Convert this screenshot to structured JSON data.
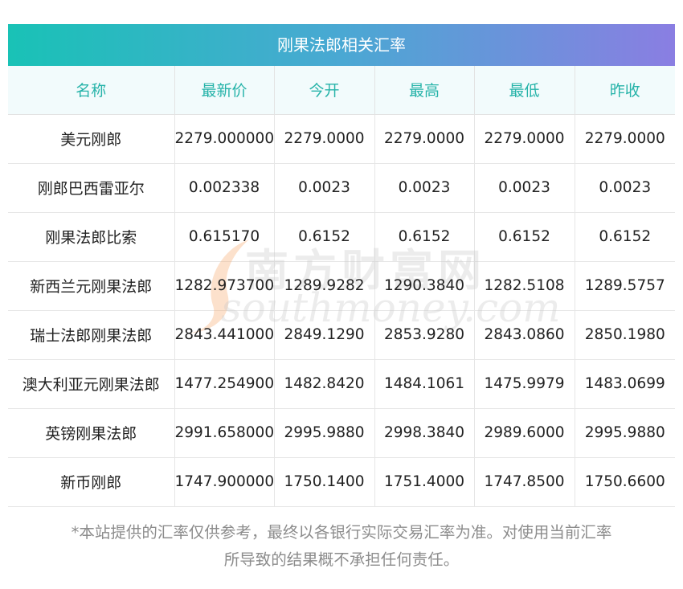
{
  "title": "刚果法郎相关汇率",
  "columns": [
    "名称",
    "最新价",
    "今开",
    "最高",
    "最低",
    "昨收"
  ],
  "rows": [
    [
      "美元刚郎",
      "2279.000000",
      "2279.0000",
      "2279.0000",
      "2279.0000",
      "2279.0000"
    ],
    [
      "刚郎巴西雷亚尔",
      "0.002338",
      "0.0023",
      "0.0023",
      "0.0023",
      "0.0023"
    ],
    [
      "刚果法郎比索",
      "0.615170",
      "0.6152",
      "0.6152",
      "0.6152",
      "0.6152"
    ],
    [
      "新西兰元刚果法郎",
      "1282.973700",
      "1289.9282",
      "1290.3840",
      "1282.5108",
      "1289.5757"
    ],
    [
      "瑞士法郎刚果法郎",
      "2843.441000",
      "2849.1290",
      "2853.9280",
      "2843.0860",
      "2850.1980"
    ],
    [
      "澳大利亚元刚果法郎",
      "1477.254900",
      "1482.8420",
      "1484.1061",
      "1475.9979",
      "1483.0699"
    ],
    [
      "英镑刚果法郎",
      "2991.658000",
      "2995.9880",
      "2998.3840",
      "2989.6000",
      "2995.9880"
    ],
    [
      "新币刚郎",
      "1747.900000",
      "1750.1400",
      "1751.4000",
      "1747.8500",
      "1750.6600"
    ]
  ],
  "watermark": {
    "cn": "南方财富网",
    "en": "southmoney.com"
  },
  "disclaimer_line1": "*本站提供的汇率仅供参考，最终以各银行实际交易汇率为准。对使用当前汇率",
  "disclaimer_line2": "所导致的结果概不承担任何责任。",
  "colors": {
    "header_text": "#26b3a9",
    "gradient_start": "#19c2b6",
    "gradient_end": "#8a7ee2"
  }
}
